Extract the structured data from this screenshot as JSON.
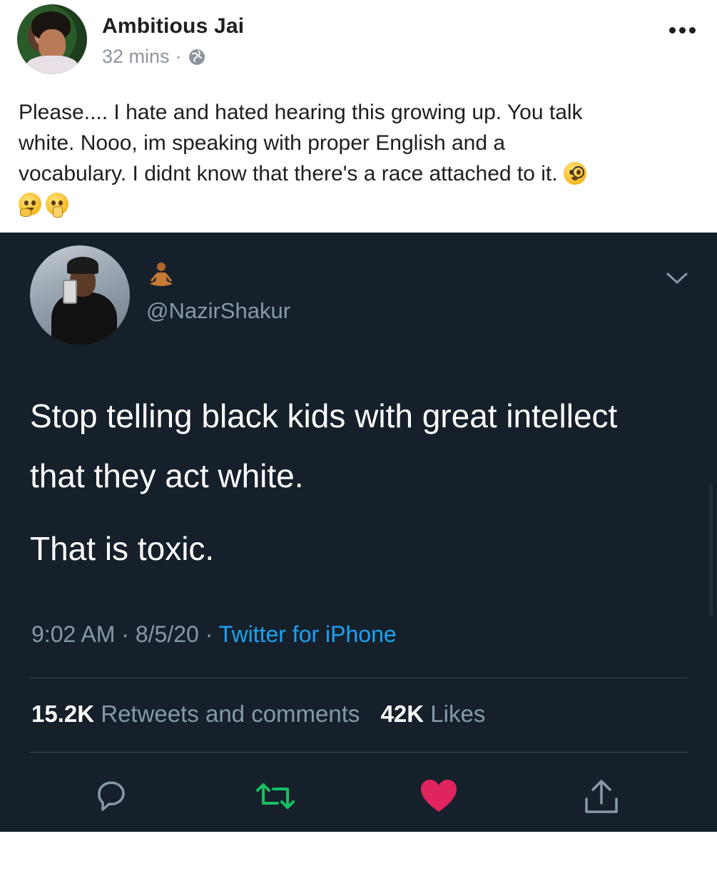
{
  "post": {
    "author_name": "Ambitious Jai",
    "time": "32 mins",
    "separator": "·",
    "text_line1": "Please.... I hate and hated hearing this growing up. You talk",
    "text_line2": "white. Nooo, im speaking with proper English and a",
    "text_line3": "vocabulary. I didnt know that there's a race attached to it."
  },
  "tweet": {
    "handle": "@NazirShakur",
    "body_para1": "Stop telling black kids with great intellect that they act white.",
    "body_para2": "That is toxic.",
    "time": "9:02 AM",
    "date": "8/5/20",
    "separator": "·",
    "source": "Twitter for iPhone",
    "retweets_count": "15.2K",
    "retweets_label": "Retweets and comments",
    "likes_count": "42K",
    "likes_label": "Likes",
    "colors": {
      "background": "#15202b",
      "secondary_text": "#8899a6",
      "link": "#1da1f2",
      "retweet": "#17bf63",
      "like": "#e0245e"
    }
  }
}
